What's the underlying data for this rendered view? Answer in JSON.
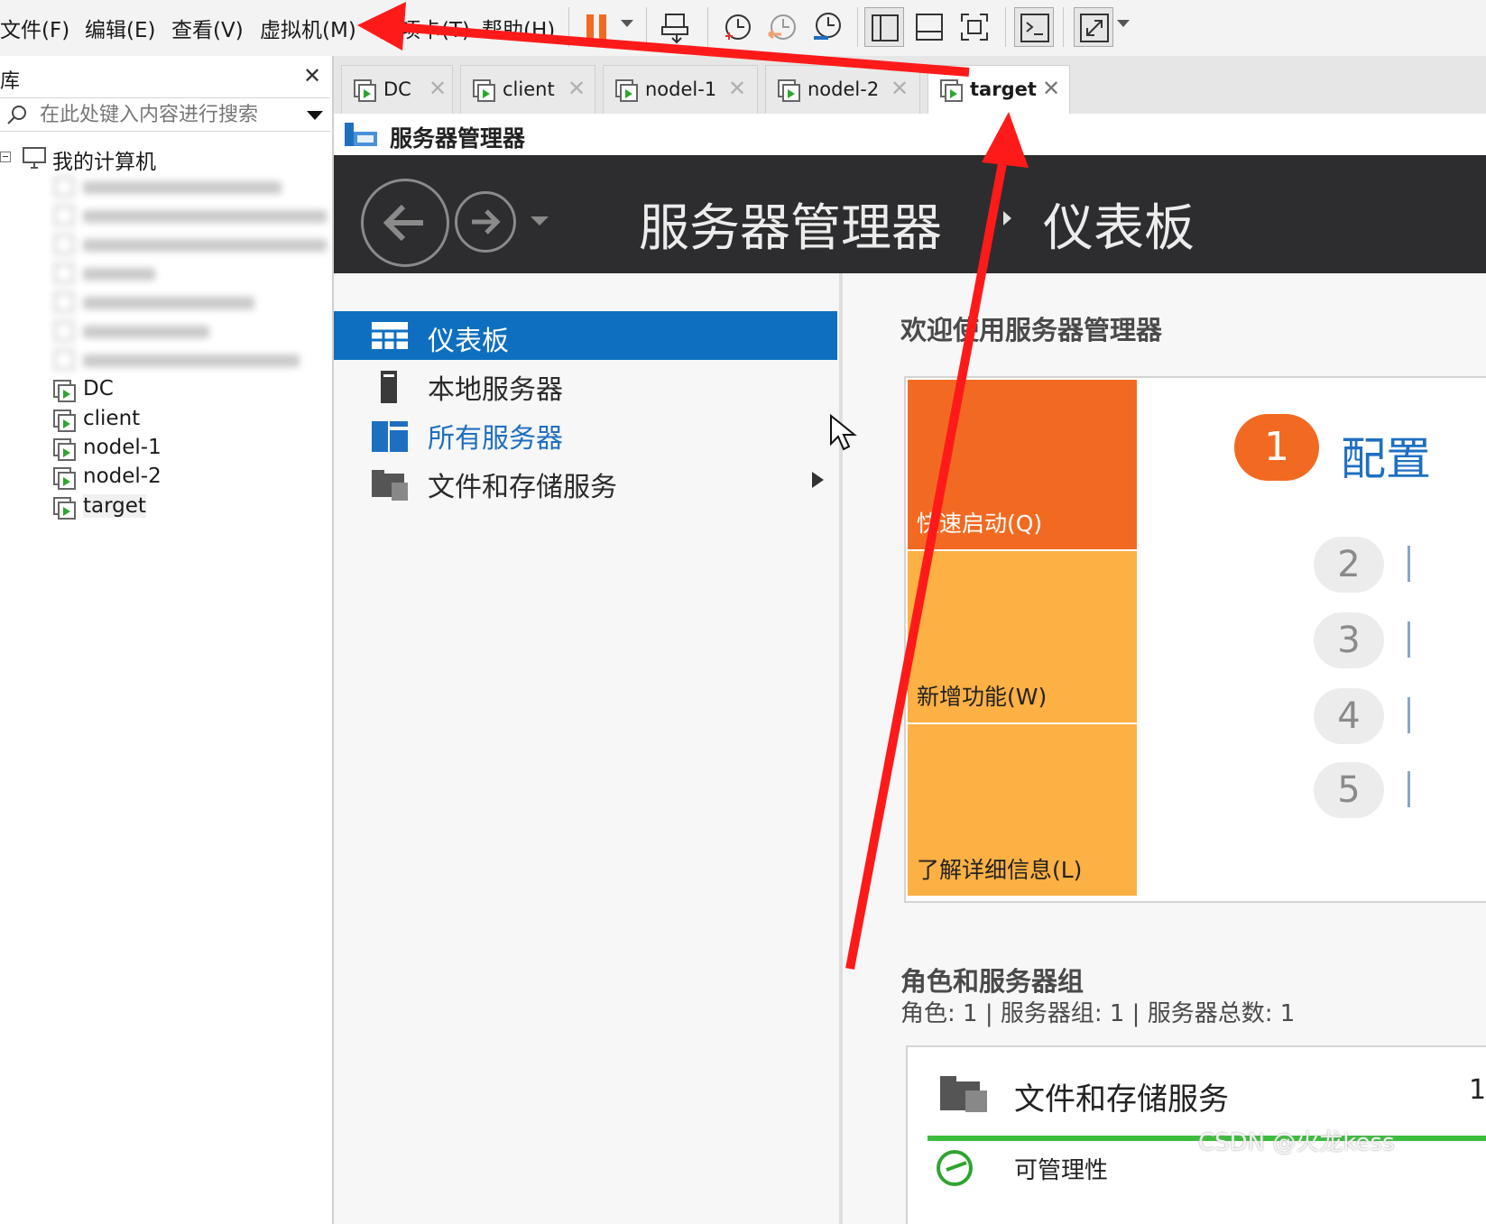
{
  "menu": {
    "items": [
      "文件(F)",
      "编辑(E)",
      "查看(V)",
      "虚拟机(M)",
      "选项卡(T)",
      "帮助(H)"
    ]
  },
  "toolbar": {
    "buttons": [
      "pause-icon",
      "send-ctrl-alt-del-icon",
      "snapshot-icon",
      "revert-snapshot-icon",
      "snapshot-manager-icon",
      "show-library-icon",
      "thumbnail-bar-icon",
      "full-screen-icon",
      "console-view-icon",
      "stretch-guest-icon"
    ],
    "pause_color": "#f26a21"
  },
  "library": {
    "title": "库",
    "search_placeholder": "在此处键入内容进行搜索",
    "root_label": "我的计算机",
    "vms": [
      "DC",
      "client",
      "nodel-1",
      "nodel-2",
      "target"
    ],
    "selected_vm": "target"
  },
  "tabs": [
    {
      "label": "DC",
      "active": false
    },
    {
      "label": "client",
      "active": false
    },
    {
      "label": "nodel-1",
      "active": false
    },
    {
      "label": "nodel-2",
      "active": false
    },
    {
      "label": "target",
      "active": true
    }
  ],
  "guest": {
    "window_title": "服务器管理器",
    "header_title": "服务器管理器",
    "header_crumb": "仪表板",
    "nav": [
      "仪表板",
      "本地服务器",
      "所有服务器",
      "文件和存储服务"
    ],
    "welcome_title": "欢迎使用服务器管理器",
    "tiles": {
      "quick_start": "快速启动(Q)",
      "whats_new": "新增功能(W)",
      "learn_more": "了解详细信息(L)"
    },
    "steps": {
      "one_number": "1",
      "one_label": "配置",
      "others": [
        "2",
        "3",
        "4",
        "5"
      ]
    },
    "roles": {
      "title": "角色和服务器组",
      "stats": "角色: 1 | 服务器组: 1 | 服务器总数: 1",
      "card_label": "文件和存储服务",
      "card_count": "1",
      "card_sub": "可管理性"
    },
    "accent_color": "#0e6fc0"
  },
  "watermark": "CSDN @火龙kess",
  "annotation_color": "#ff1a1a"
}
